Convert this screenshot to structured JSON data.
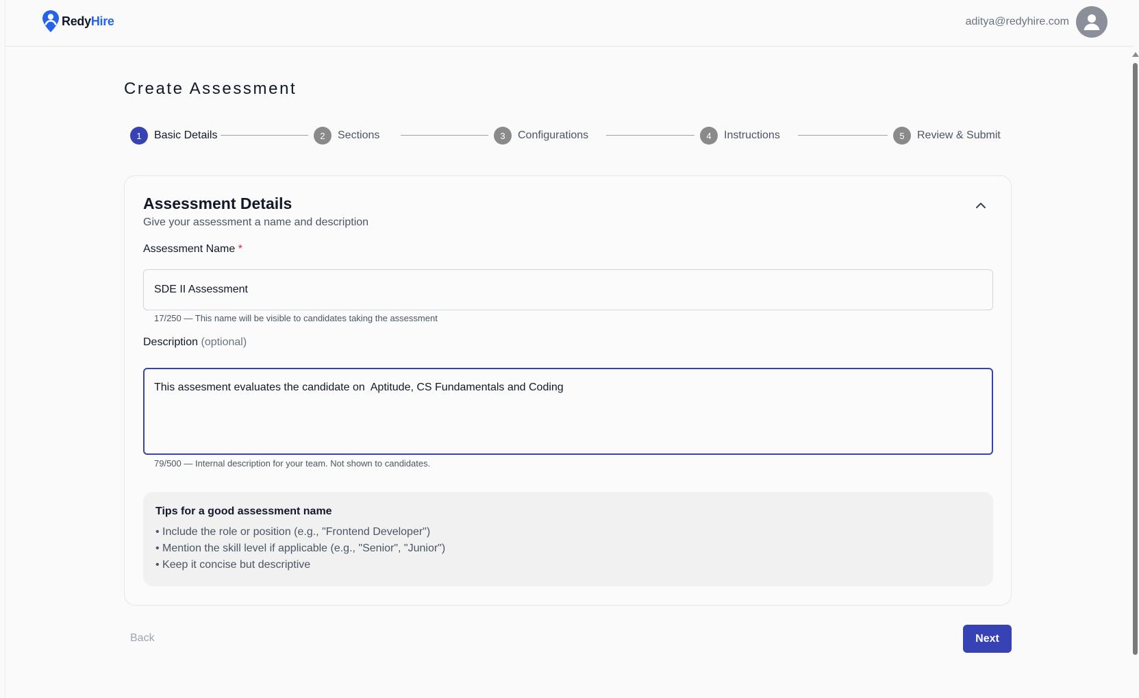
{
  "header": {
    "logo": {
      "part1": "Redy",
      "part2": "Hire",
      "icon": "location-pin-person-icon"
    },
    "user_email": "aditya@redyhire.com",
    "avatar_icon": "user-avatar-icon"
  },
  "page": {
    "title": "Create Assessment"
  },
  "stepper": {
    "steps": [
      {
        "number": "1",
        "label": "Basic Details",
        "active": true
      },
      {
        "number": "2",
        "label": "Sections",
        "active": false
      },
      {
        "number": "3",
        "label": "Configurations",
        "active": false
      },
      {
        "number": "4",
        "label": "Instructions",
        "active": false
      },
      {
        "number": "5",
        "label": "Review & Submit",
        "active": false
      }
    ]
  },
  "card": {
    "title": "Assessment Details",
    "subtitle": "Give your assessment a name and description",
    "collapse_icon": "chevron-up-icon",
    "name_field": {
      "label": "Assessment Name",
      "required_mark": "*",
      "value": "SDE II Assessment",
      "helper": "17/250 — This name will be visible to candidates taking the assessment"
    },
    "description_field": {
      "label": "Description",
      "optional_text": "(optional)",
      "value": "This assesment evaluates the candidate on  Aptitude, CS Fundamentals and Coding",
      "helper": "79/500 — Internal description for your team. Not shown to candidates."
    },
    "tips": {
      "title": "Tips for a good assessment name",
      "items": [
        "• Include the role or position (e.g., \"Frontend Developer\")",
        "• Mention the skill level if applicable (e.g., \"Senior\", \"Junior\")",
        "• Keep it concise but descriptive"
      ]
    }
  },
  "footer": {
    "back_label": "Back",
    "next_label": "Next"
  },
  "colors": {
    "primary": "#3742b4",
    "brand_blue": "#2563eb",
    "required": "#dc2626",
    "step_inactive": "#8a8a8a"
  }
}
